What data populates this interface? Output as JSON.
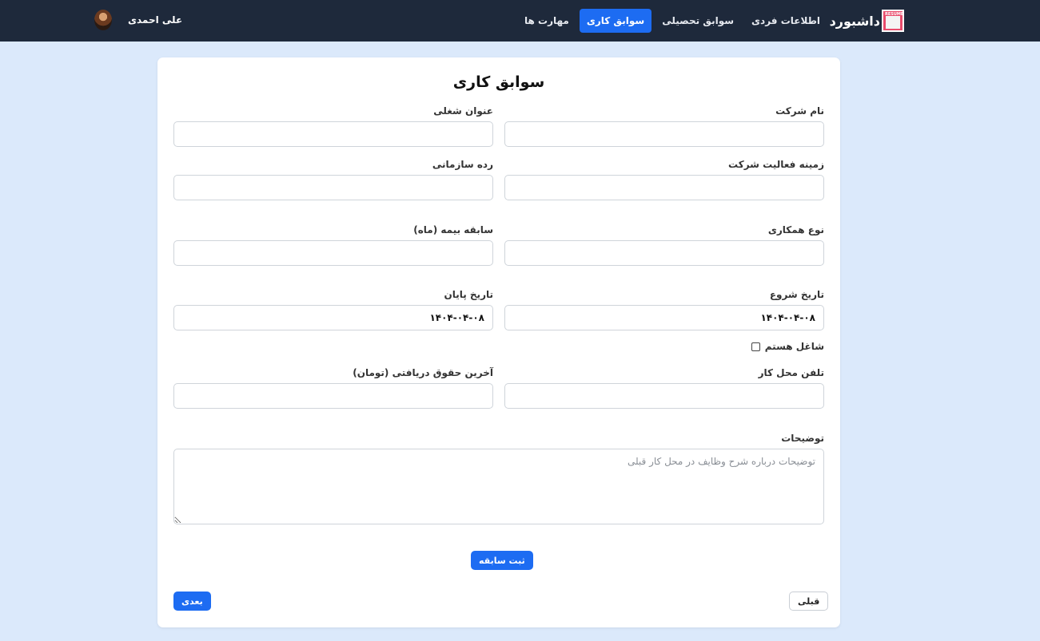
{
  "nav": {
    "brand": "داشبورد",
    "logo_text": "RESUME",
    "links": [
      {
        "label": "اطلاعات فردی",
        "active": false
      },
      {
        "label": "سوابق تحصیلی",
        "active": false
      },
      {
        "label": "سوابق کاری",
        "active": true
      },
      {
        "label": "مهارت ها",
        "active": false
      }
    ],
    "user_name": "علی احمدی"
  },
  "form": {
    "title": "سوابق کاری",
    "company_name": {
      "label": "نام شرکت",
      "value": ""
    },
    "job_title": {
      "label": "عنوان شغلی",
      "value": ""
    },
    "company_field": {
      "label": "زمینه فعالیت شرکت",
      "value": ""
    },
    "org_rank": {
      "label": "رده سازمانی",
      "value": ""
    },
    "cooperation_type": {
      "label": "نوع همکاری",
      "value": ""
    },
    "insurance_months": {
      "label": "سابقه بیمه (ماه)",
      "value": ""
    },
    "start_date": {
      "label": "تاریخ شروع",
      "value": "۱۴۰۴-۰۴-۰۸"
    },
    "end_date": {
      "label": "تاریخ پایان",
      "value": "۱۴۰۴-۰۴-۰۸"
    },
    "currently_working": {
      "label": "شاغل هستم",
      "checked": false
    },
    "work_phone": {
      "label": "تلفن محل کار",
      "value": ""
    },
    "last_salary": {
      "label": "آخرین حقوق دریافتی (تومان)",
      "value": ""
    },
    "description": {
      "label": "توضیحات",
      "placeholder": "توضیحات درباره شرح وظایف در محل کار قبلی",
      "value": ""
    },
    "submit_label": "ثبت سابقه",
    "prev_label": "قبلی",
    "next_label": "بعدی"
  },
  "colors": {
    "navbar": "#1e293b",
    "accent": "#1d6cf2",
    "background": "#dbe9fb"
  }
}
